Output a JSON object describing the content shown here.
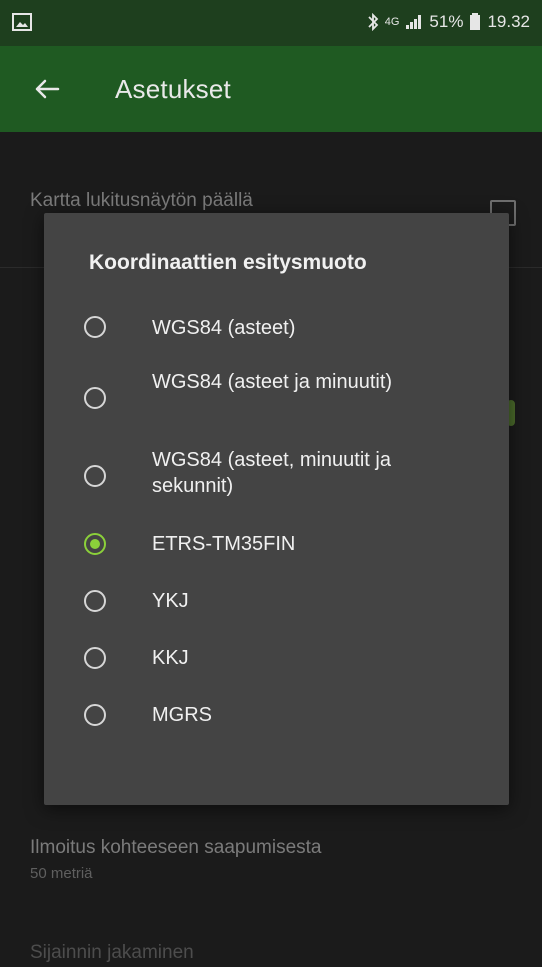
{
  "status_bar": {
    "battery": "51%",
    "time": "19.32",
    "network": "4G"
  },
  "app_bar": {
    "title": "Asetukset"
  },
  "settings": {
    "map_lock_label": "Kartta lukitusnäytön päällä",
    "arrival_label": "Ilmoitus kohteeseen saapumisesta",
    "arrival_value": "50 metriä",
    "share_label": "Sijainnin jakaminen"
  },
  "dialog": {
    "title": "Koordinaattien esitysmuoto",
    "options": [
      {
        "label": "WGS84 (asteet)",
        "selected": false
      },
      {
        "label": "WGS84 (asteet ja minuutit)",
        "selected": false
      },
      {
        "label": "WGS84 (asteet, minuutit ja sekunnit)",
        "selected": false
      },
      {
        "label": "ETRS-TM35FIN",
        "selected": true
      },
      {
        "label": "YKJ",
        "selected": false
      },
      {
        "label": "KKJ",
        "selected": false
      },
      {
        "label": "MGRS",
        "selected": false
      }
    ]
  },
  "colors": {
    "accent": "#8bd03a",
    "app_bar": "#1f5a22",
    "dialog_bg": "#444444"
  }
}
